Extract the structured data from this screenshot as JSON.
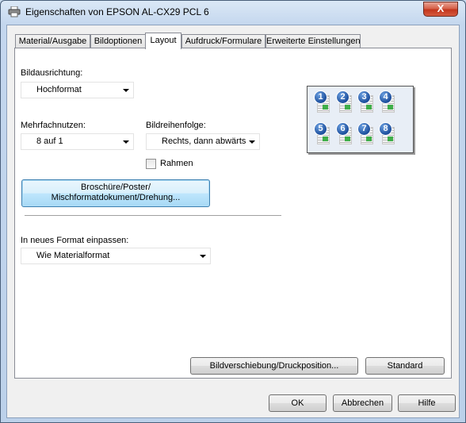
{
  "window": {
    "title": "Eigenschaften von EPSON AL-CX29 PCL 6",
    "close_symbol": "X"
  },
  "tabs": [
    {
      "label": "Material/Ausgabe"
    },
    {
      "label": "Bildoptionen"
    },
    {
      "label": "Layout",
      "active": true
    },
    {
      "label": "Aufdruck/Formulare"
    },
    {
      "label": "Erweiterte Einstellungen"
    }
  ],
  "layout": {
    "orientation_label": "Bildausrichtung:",
    "orientation_value": "Hochformat",
    "nup_label": "Mehrfachnutzen:",
    "nup_value": "8 auf 1",
    "order_label": "Bildreihenfolge:",
    "order_value": "Rechts, dann abwärts",
    "border_label": "Rahmen",
    "border_checked": false,
    "booklet_button_line1": "Broschüre/Poster/",
    "booklet_button_line2": "Mischformatdokument/Drehung...",
    "fit_label": "In neues Format einpassen:",
    "fit_value": "Wie Materialformat",
    "shift_button": "Bildverschiebung/Druckposition...",
    "default_button": "Standard"
  },
  "preview": {
    "pages": [
      "1",
      "2",
      "3",
      "4",
      "5",
      "6",
      "7",
      "8"
    ]
  },
  "footer": {
    "ok": "OK",
    "cancel": "Abbrechen",
    "help": "Hilfe"
  }
}
